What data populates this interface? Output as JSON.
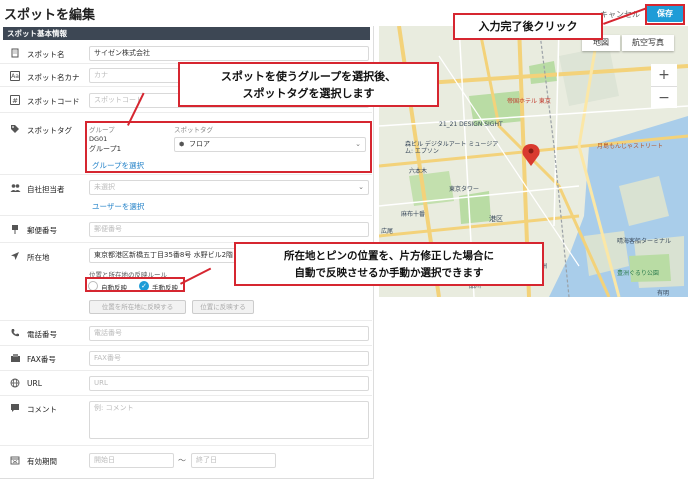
{
  "header": {
    "title": "スポットを編集",
    "cancel_label": "キャンセル",
    "save_label": "保存"
  },
  "form": {
    "section_title": "スポット基本情報",
    "spot_name": {
      "label": "スポット名",
      "value": "サイゼン株式会社"
    },
    "spot_kana": {
      "label": "スポット名カナ",
      "placeholder": "カナ"
    },
    "spot_code": {
      "label": "スポットコード",
      "placeholder": "スポットコード"
    },
    "spot_tag": {
      "label": "スポットタグ",
      "group_header": "グループ",
      "tag_header": "スポットタグ",
      "group_code": "DG01",
      "group_name": "グループ1",
      "tag_value": "フロア",
      "select_group_link": "グループを選択"
    },
    "staff": {
      "label": "自社担当者",
      "placeholder": "未選択",
      "select_user_link": "ユーザーを選択"
    },
    "postal": {
      "label": "郵便番号",
      "placeholder": "郵便番号"
    },
    "address": {
      "label": "所在地",
      "value": "東京都港区新橋五丁目35番8号 水野ビル2階",
      "rule_label": "位置と所在地の反映ルール",
      "auto_label": "自動反映",
      "manual_label": "手動反映",
      "reflect_to_address": "位置を所在地に反映する",
      "reflect_to_position": "位置に反映する"
    },
    "phone": {
      "label": "電話番号",
      "placeholder": "電話番号"
    },
    "fax": {
      "label": "FAX番号",
      "placeholder": "FAX番号"
    },
    "url": {
      "label": "URL",
      "placeholder": "URL"
    },
    "comment": {
      "label": "コメント",
      "placeholder": "例: コメント"
    },
    "validity": {
      "label": "有効期間",
      "start_placeholder": "開始日",
      "separator": "〜",
      "end_placeholder": "終了日"
    }
  },
  "map": {
    "tab_map": "地図",
    "tab_satellite": "航空写真",
    "zoom_in": "+",
    "zoom_out": "−",
    "labels": {
      "l1": "帝国ホテル 東京",
      "l2": "21_21 DESIGN SIGHT",
      "l3": "森ビル デジタルアート ミュージアム: エプソン",
      "l4": "東京タワー",
      "l5": "六本木",
      "l6": "月島もんじゃストリート",
      "l7": "晴海客船ターミナル",
      "l8": "豊洲ぐるり公園",
      "l9": "有明",
      "l10": "品川",
      "l11": "天王洲",
      "l12": "麻布十番",
      "l13": "港区",
      "l14": "広尾"
    }
  },
  "callouts": {
    "save_note": "入力完了後クリック",
    "tag_note_line1": "スポットを使うグループを選択後、",
    "tag_note_line2": "スポットタグを選択します",
    "address_note_line1": "所在地とピンの位置を、片方修正した場合に",
    "address_note_line2": "自動で反映させるか手動か選択できます"
  },
  "colors": {
    "accent": "#1e9cd7",
    "callout_border": "#d62630",
    "section_header": "#3d4754",
    "link": "#1e7fc7",
    "map_pin": "#d93a2f"
  }
}
